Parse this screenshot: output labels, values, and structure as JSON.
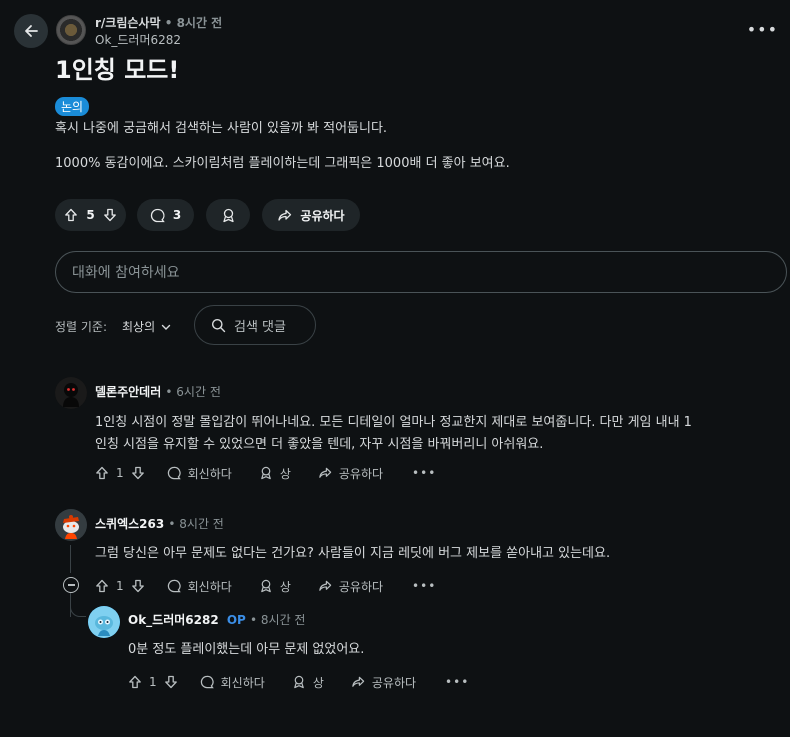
{
  "post": {
    "subreddit": "r/크림슨사막",
    "time": "8시간 전",
    "author": "Ok_드러머6282",
    "title": "1인칭 모드!",
    "flair": "논의",
    "paragraphs": [
      "혹시 나중에 궁금해서 검색하는 사람이 있을까 봐 적어둡니다.",
      "1000% 동감이에요. 스카이림처럼 플레이하는데 그래픽은 1000배 더 좋아 보여요."
    ],
    "votes": "5",
    "comments_count": "3",
    "share_label": "공유하다"
  },
  "comment_box": {
    "placeholder": "대화에 참여하세요"
  },
  "sort": {
    "label": "정렬 기준:",
    "value": "최상의"
  },
  "comment_search": {
    "placeholder": "검색 댓글"
  },
  "comments": [
    {
      "author": "델론주안데러",
      "time": "6시간 전",
      "text_lines": [
        "1인칭 시점이 정말 몰입감이 뛰어나네요. 모든 디테일이 얼마나 정교한지 제대로 보여줍니다. 다만 게임 내내 1",
        "인칭 시점을 유지할 수 있었으면 더 좋았을 텐데, 자꾸 시점을 바꿔버리니 아쉬워요."
      ],
      "votes": "1",
      "reply_label": "회신하다",
      "award_label": "상",
      "share_label": "공유하다"
    },
    {
      "author": "스퀴엑스263",
      "time": "8시간 전",
      "text_lines": [
        "그럼 당신은 아무 문제도 없다는 건가요? 사람들이 지금 레딧에 버그 제보를 쏟아내고 있는데요."
      ],
      "votes": "1",
      "reply_label": "회신하다",
      "award_label": "상",
      "share_label": "공유하다"
    },
    {
      "author": "Ok_드러머6282",
      "op_badge": "OP",
      "time": "8시간 전",
      "text_lines": [
        "0분 정도 플레이했는데 아무 문제 없었어요."
      ],
      "votes": "1",
      "reply_label": "회신하다",
      "award_label": "상",
      "share_label": "공유하다"
    }
  ],
  "colors": {
    "background": "#0e1113",
    "flair": "#1a8cd8",
    "op": "#3b8ee6"
  }
}
